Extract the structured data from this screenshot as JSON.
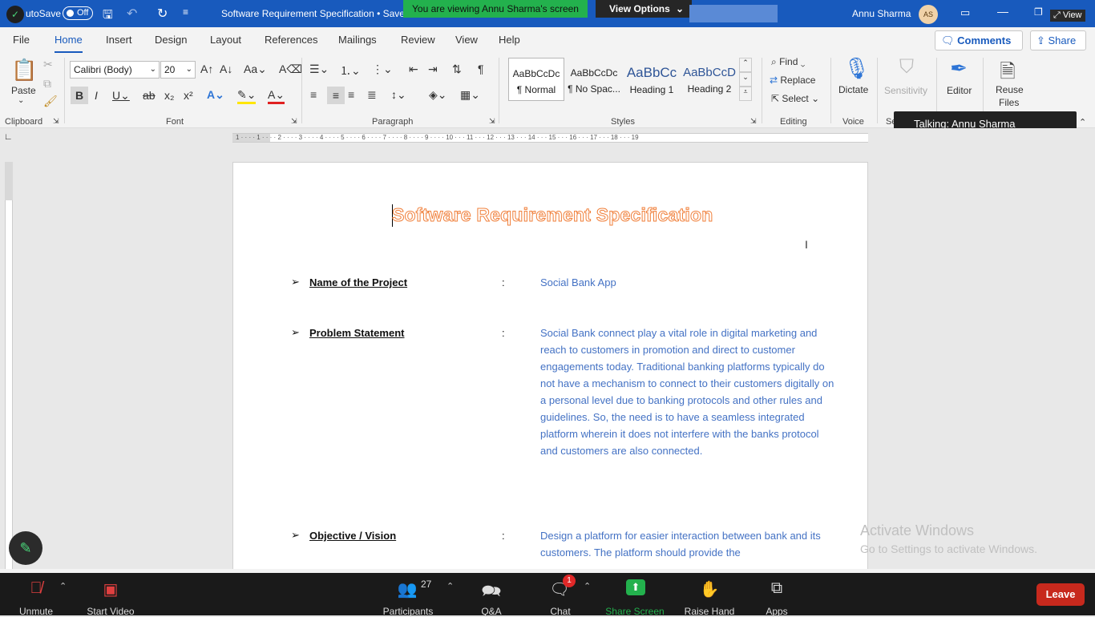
{
  "titlebar": {
    "autosave": "utoSave",
    "autosave_toggle": "Off",
    "doc_title": "Software Requirement Specification • Save",
    "viewing_banner": "You are viewing Annu Sharma's screen",
    "view_options": "View Options",
    "user_name": "Annu Sharma",
    "user_initials": "AS",
    "view_label": "View"
  },
  "tabs": [
    "File",
    "Home",
    "Insert",
    "Design",
    "Layout",
    "References",
    "Mailings",
    "Review",
    "View",
    "Help"
  ],
  "tab_actions": {
    "comments": "Comments",
    "share": "Share"
  },
  "ribbon": {
    "paste": "Paste",
    "font_name": "Calibri (Body)",
    "font_size": "20",
    "groups": {
      "clipboard": "Clipboard",
      "font": "Font",
      "paragraph": "Paragraph",
      "styles": "Styles",
      "editing": "Editing",
      "voice": "Voice",
      "sensitivity_cut": "Se"
    },
    "styles": [
      {
        "preview": "AaBbCcDc",
        "name": "¶ Normal"
      },
      {
        "preview": "AaBbCcDc",
        "name": "¶ No Spac..."
      },
      {
        "preview": "AaBbCc",
        "name": "Heading 1"
      },
      {
        "preview": "AaBbCcD",
        "name": "Heading 2"
      }
    ],
    "find": "Find",
    "replace": "Replace",
    "select": "Select",
    "dictate": "Dictate",
    "sensitivity": "Sensitivity",
    "editor": "Editor",
    "reuse_files_1": "Reuse",
    "reuse_files_2": "Files"
  },
  "talking": "Talking: Annu Sharma",
  "document": {
    "heading": "Software Requirement Specification",
    "rows": [
      {
        "label": "Name of the Project",
        "colon": ":",
        "value": "Social Bank App"
      },
      {
        "label": "Problem Statement",
        "colon": ":",
        "value": "Social Bank connect play a vital role in digital marketing and reach to customers in promotion and direct to customer engagements today. Traditional banking platforms typically do not have a mechanism to connect to their customers digitally on a personal level due to banking protocols and other rules and guidelines. So, the need is to have a seamless integrated platform wherein it does not interfere with the banks protocol and customers are also connected."
      },
      {
        "label": "Objective / Vision",
        "colon": ":",
        "value": "Design a platform for easier interaction between bank and its customers. The platform should provide the"
      }
    ]
  },
  "watermark": {
    "line1": "Activate Windows",
    "line2": "Go to Settings to activate Windows."
  },
  "zoom": {
    "unmute": "Unmute",
    "start_video": "Start Video",
    "participants": "Participants",
    "participants_count": "27",
    "qa": "Q&A",
    "chat": "Chat",
    "chat_badge": "1",
    "share_screen": "Share Screen",
    "raise_hand": "Raise Hand",
    "apps": "Apps",
    "leave": "Leave"
  },
  "colors": {
    "word_blue": "#185abd",
    "heading_orange": "#f07f3a",
    "body_blue": "#4472c4",
    "zoom_green": "#23b14d",
    "leave_red": "#c7291d"
  }
}
